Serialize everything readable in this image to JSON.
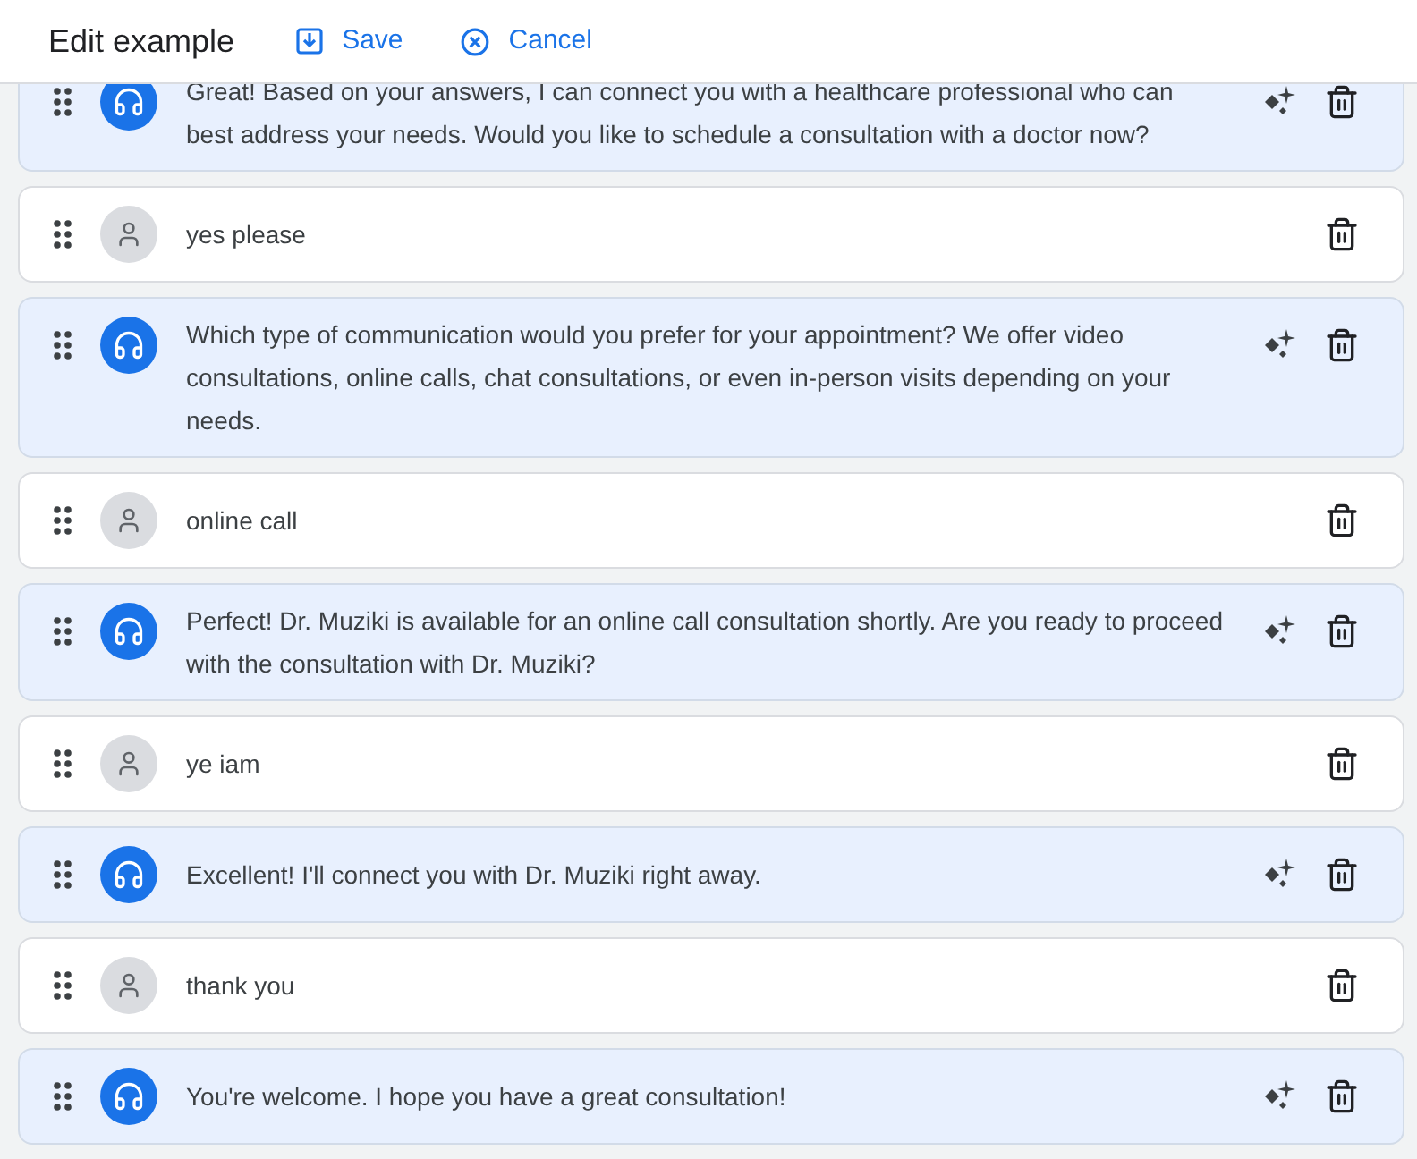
{
  "header": {
    "title": "Edit example",
    "actions": [
      {
        "kind": "save",
        "label": "Save"
      },
      {
        "kind": "cancel",
        "label": "Cancel"
      }
    ]
  },
  "messages": [
    {
      "kind": "agent",
      "text": "Great! Based on your answers, I can connect you with a healthcare professional who can best address your needs. Would you like to schedule a consultation with a doctor now?"
    },
    {
      "kind": "user",
      "text": "yes please"
    },
    {
      "kind": "agent",
      "text": "Which type of communication would you prefer for your appointment? We offer video consultations, online calls, chat consultations, or even in-person visits depending on your needs."
    },
    {
      "kind": "user",
      "text": "online call"
    },
    {
      "kind": "agent",
      "text": "Perfect! Dr. Muziki is available for an online call consultation shortly. Are you ready to proceed with the consultation with Dr. Muziki?"
    },
    {
      "kind": "user",
      "text": "ye iam"
    },
    {
      "kind": "agent",
      "text": "Excellent! I'll connect you with Dr. Muziki right away."
    },
    {
      "kind": "user",
      "text": "thank you"
    },
    {
      "kind": "agent",
      "text": "You're welcome. I hope you have a great consultation!"
    }
  ]
}
